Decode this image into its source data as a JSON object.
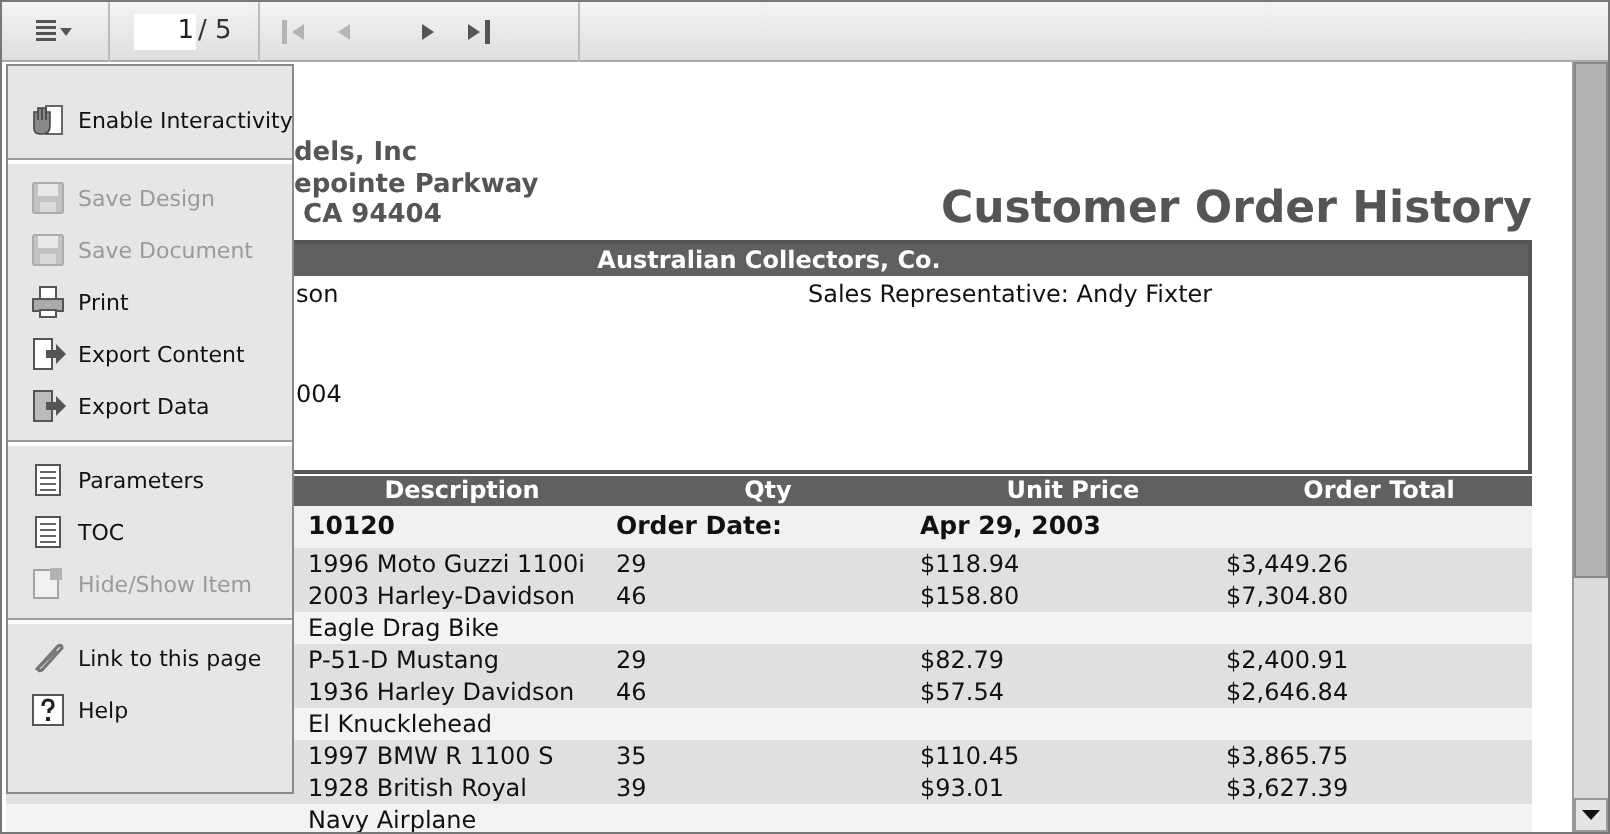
{
  "toolbar": {
    "page_field": {
      "value": "1"
    },
    "page_total": "/ 5",
    "nav_buttons": [
      {
        "kind": "first",
        "disabled": true
      },
      {
        "kind": "prev",
        "disabled": true
      },
      {
        "kind": "next",
        "disabled": false
      },
      {
        "kind": "last",
        "disabled": false
      }
    ]
  },
  "menu": {
    "groups": [
      {
        "items": [
          {
            "label": "Enable Interactivity",
            "disabled": false
          }
        ]
      },
      {
        "items": [
          {
            "label": "Save Design",
            "disabled": true
          },
          {
            "label": "Save Document",
            "disabled": true
          },
          {
            "label": "Print",
            "disabled": false
          },
          {
            "label": "Export Content",
            "disabled": false
          },
          {
            "label": "Export Data",
            "disabled": false
          }
        ]
      },
      {
        "items": [
          {
            "label": "Parameters",
            "disabled": false
          },
          {
            "label": "TOC",
            "disabled": false
          },
          {
            "label": "Hide/Show Item",
            "disabled": true
          }
        ]
      },
      {
        "items": [
          {
            "label": "Link to this page",
            "disabled": false
          },
          {
            "label": "Help",
            "disabled": false
          }
        ]
      }
    ]
  },
  "report": {
    "company_lines": [
      "dels, Inc",
      "epointe Parkway",
      " CA 94404"
    ],
    "title": "Customer Order History",
    "customer": {
      "name": "Australian Collectors, Co.",
      "contact_fragment": "son",
      "sales_rep": "Sales Representative: Andy Fixter",
      "phone_fragment": "004"
    },
    "table": {
      "columns": [
        "Description",
        "Qty",
        "Unit Price",
        "Order Total"
      ],
      "order": {
        "number": "10120",
        "date_label": "Order Date:",
        "date": "Apr 29, 2003"
      },
      "rows": [
        {
          "description": "1996 Moto Guzzi 1100i",
          "qty": "29",
          "unit_price": "$118.94",
          "order_total": "$3,449.26"
        },
        {
          "description": "2003 Harley-Davidson Eagle Drag Bike",
          "qty": "46",
          "unit_price": "$158.80",
          "order_total": "$7,304.80"
        },
        {
          "description": "P-51-D Mustang",
          "qty": "29",
          "unit_price": "$82.79",
          "order_total": "$2,400.91"
        },
        {
          "description": "1936 Harley Davidson El Knucklehead",
          "qty": "46",
          "unit_price": "$57.54",
          "order_total": "$2,646.84"
        },
        {
          "description": "1997 BMW R 1100 S",
          "qty": "35",
          "unit_price": "$110.45",
          "order_total": "$3,865.75"
        },
        {
          "description": "1928 British Royal Navy Airplane",
          "qty": "39",
          "unit_price": "$93.01",
          "order_total": "$3,627.39"
        }
      ]
    }
  }
}
